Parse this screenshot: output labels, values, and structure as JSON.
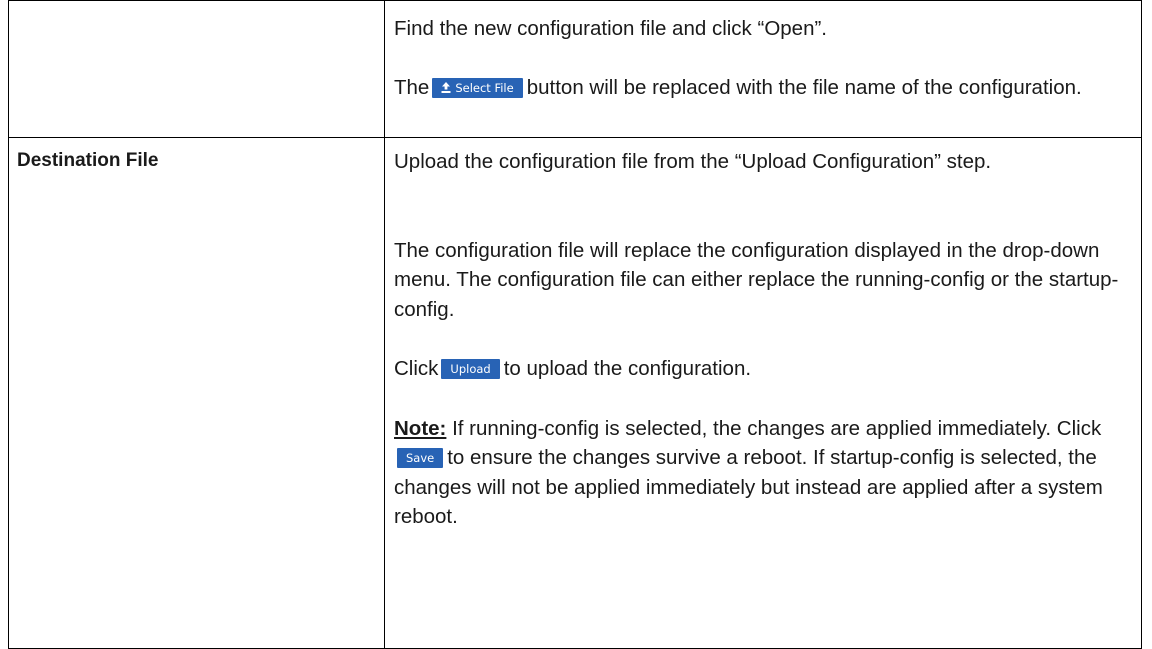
{
  "rows": [
    {
      "label": "",
      "lines": {
        "find": "Find the new configuration file and click “Open”.",
        "the_prefix": "The",
        "select_button": "Select File",
        "the_suffix": "button will be replaced with the file name of the configuration."
      }
    },
    {
      "label": "Destination File",
      "lines": {
        "upload_step": "Upload the configuration file from the “Upload Configuration” step.",
        "replace_desc": "The configuration file will replace the configuration displayed in the drop-down menu. The configuration file can either replace the running-config or the startup-config.",
        "click_prefix": "Click",
        "upload_button": "Upload",
        "click_suffix": "to upload the configuration.",
        "note_label": "Note:",
        "note_part1": "If running-config is selected, the changes are applied immediately. Click",
        "save_button": "Save",
        "note_part2": "to ensure the changes survive a reboot. If startup-config is selected, the changes will not be applied immediately but instead are applied after a system reboot."
      }
    }
  ],
  "icons": {
    "select_file_icon": "upload-icon"
  },
  "colors": {
    "button_bg": "#2863b5",
    "button_text": "#ffffff",
    "border": "#000000"
  }
}
